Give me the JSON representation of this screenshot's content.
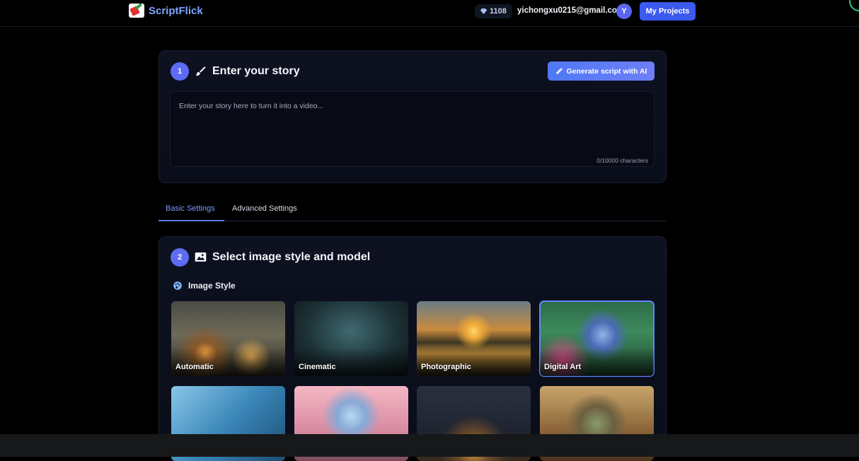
{
  "header": {
    "logo_text": "ScriptFlick",
    "credits": "1108",
    "email": "yichongxu0215@gmail.com",
    "avatar_initial": "Y",
    "my_projects_label": "My Projects"
  },
  "story": {
    "step": "1",
    "title": "Enter your story",
    "generate_label": "Generate script with AI",
    "placeholder": "Enter your story here to turn it into a video...",
    "char_count": "0/10000 characters"
  },
  "tabs": {
    "basic": "Basic Settings",
    "advanced": "Advanced Settings",
    "active": "basic"
  },
  "style_section": {
    "step": "2",
    "title": "Select image style and model",
    "subtitle": "Image Style",
    "styles": [
      {
        "label": "Automatic"
      },
      {
        "label": "Cinematic"
      },
      {
        "label": "Photographic"
      },
      {
        "label": "Digital Art",
        "selected": true
      }
    ]
  },
  "colors": {
    "accent": "#3c59f0",
    "step_badge": "#5d6cf3",
    "tab_active": "#7b9cff"
  }
}
